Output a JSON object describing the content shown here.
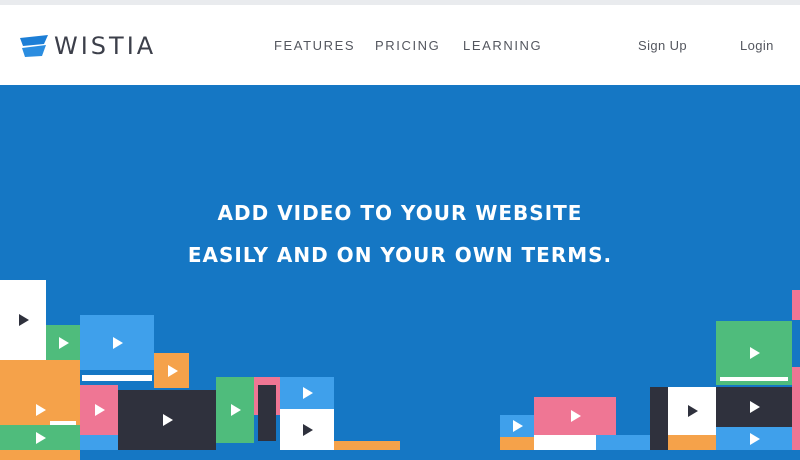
{
  "brand": {
    "name": "WISTIA",
    "logo_color": "#1c7ed6"
  },
  "nav": {
    "features": "FEATURES",
    "pricing": "PRICING",
    "learning": "LEARNING",
    "signup": "Sign Up",
    "login": "Login"
  },
  "hero": {
    "line1": "ADD VIDEO TO YOUR WEBSITE",
    "line2": "EASILY AND ON YOUR OWN TERMS.",
    "background": "#1577c4"
  },
  "colors": {
    "green": "#4fbc7c",
    "orange": "#f5a24a",
    "pink": "#ef7694",
    "dark": "#2f313d",
    "blue": "#3fa0eb",
    "white": "#ffffff"
  }
}
